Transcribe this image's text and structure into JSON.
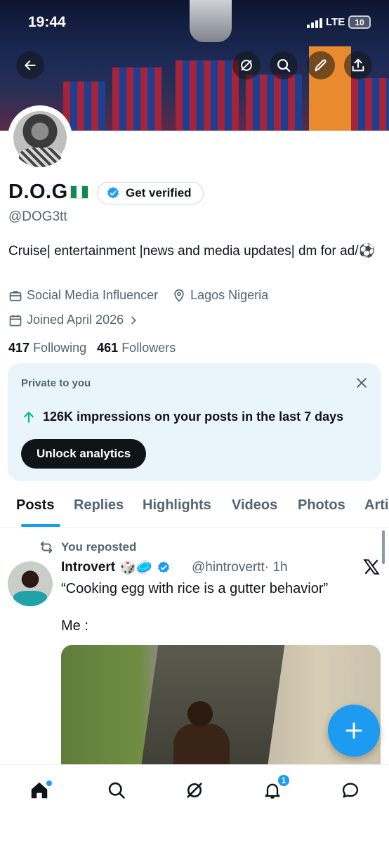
{
  "status_bar": {
    "time": "19:44",
    "network": "LTE",
    "battery": "10"
  },
  "profile": {
    "display_name": "D.O.G",
    "verify_label": "Get verified",
    "handle": "@DOG3tt",
    "bio": "Cruise| entertainment |news and media updates| dm for ad/⚽",
    "category": "Social Media Influencer",
    "location": "Lagos Nigeria",
    "joined": "Joined April 2026",
    "following_count": "417",
    "following_label": "Following",
    "followers_count": "461",
    "followers_label": "Followers"
  },
  "analytics_card": {
    "private_label": "Private to you",
    "impressions_text": "126K impressions on your posts in the last 7 days",
    "button_label": "Unlock analytics"
  },
  "tabs": [
    {
      "label": "Posts",
      "active": true
    },
    {
      "label": "Replies"
    },
    {
      "label": "Highlights"
    },
    {
      "label": "Videos"
    },
    {
      "label": "Photos"
    },
    {
      "label": "Arti"
    }
  ],
  "post": {
    "repost_label": "You reposted",
    "author_name": "Introvert",
    "author_emojis": "🎲🥏",
    "author_handle": "@hintrovertt",
    "time": "· 1h",
    "text": "“Cooking egg with rice is a gutter behavior”",
    "text_line2": "Me :"
  },
  "nav": {
    "notifications_badge": "1"
  },
  "colors": {
    "accent": "#1d9bf0",
    "text": "#0f1419",
    "muted": "#536471",
    "card_bg": "#eaf4fb"
  }
}
